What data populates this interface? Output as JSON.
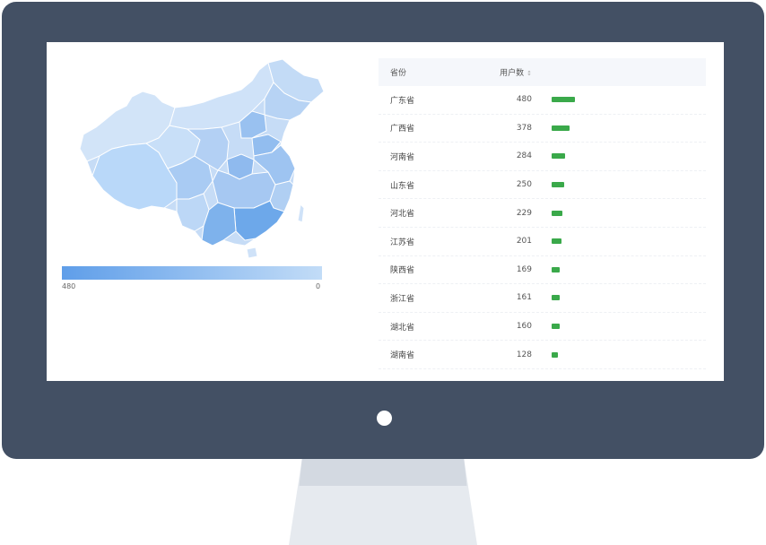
{
  "legend": {
    "min_label": "480",
    "max_label": "0"
  },
  "table": {
    "header": {
      "province": "省份",
      "users": "用户数",
      "sort_icon": "↕"
    },
    "rows": [
      {
        "province": "广东省",
        "value": 480
      },
      {
        "province": "广西省",
        "value": 378
      },
      {
        "province": "河南省",
        "value": 284
      },
      {
        "province": "山东省",
        "value": 250
      },
      {
        "province": "河北省",
        "value": 229
      },
      {
        "province": "江苏省",
        "value": 201
      },
      {
        "province": "陕西省",
        "value": 169
      },
      {
        "province": "浙江省",
        "value": 161
      },
      {
        "province": "湖北省",
        "value": 160
      },
      {
        "province": "湖南省",
        "value": 128
      }
    ],
    "max_value": 480,
    "bar_color": "#3aa94a"
  },
  "colors": {
    "monitor": "#435064",
    "map_light": "#c2dcf7",
    "map_dark": "#5f9ee9"
  }
}
